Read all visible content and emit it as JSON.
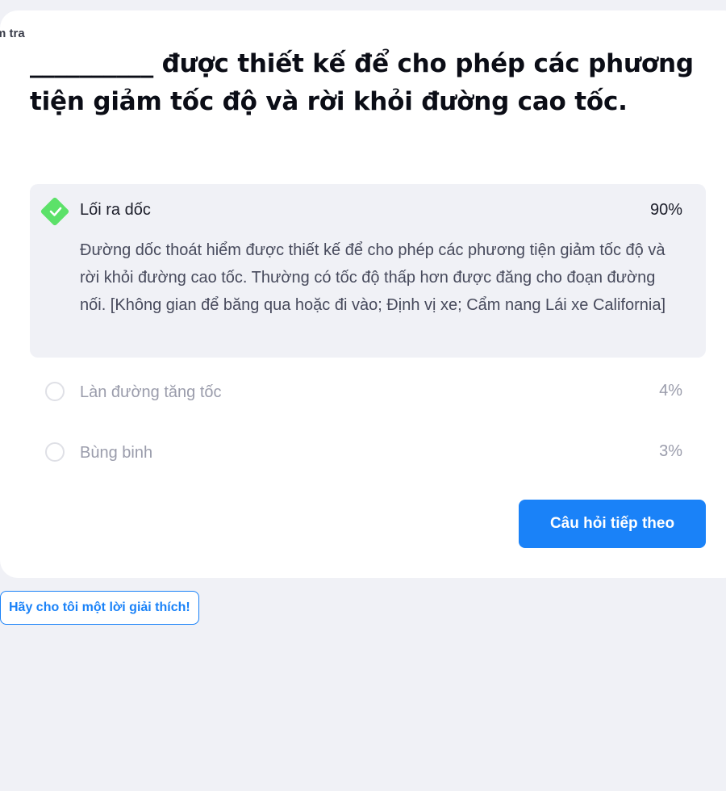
{
  "breadcrumb": "m tra",
  "question": "__________ được thiết kế để cho phép các phương tiện giảm tốc độ và rời khỏi đường cao tốc.",
  "options": [
    {
      "label": "Lối ra dốc",
      "percent": "90%",
      "state": "correct",
      "explanation": "Đường dốc thoát hiểm được thiết kế để cho phép các phương tiện giảm tốc độ và rời khỏi đường cao tốc. Thường có tốc độ thấp hơn được đăng cho đoạn đường nối. [Không gian để băng qua hoặc đi vào; Định vị xe; Cẩm nang Lái xe California]"
    },
    {
      "label": "Làn đường tăng tốc",
      "percent": "4%",
      "state": "unselected"
    },
    {
      "label": "Bùng binh",
      "percent": "3%",
      "state": "unselected"
    }
  ],
  "buttons": {
    "next": "Câu hỏi tiếp theo",
    "explain": "Hãy cho tôi một lời giải thích!"
  },
  "colors": {
    "accent": "#1a82f8",
    "correct": "#5ce169",
    "background": "#f0f1f6"
  },
  "icons": {
    "correct": "check-diamond-icon",
    "unselected": "radio-circle-icon"
  }
}
